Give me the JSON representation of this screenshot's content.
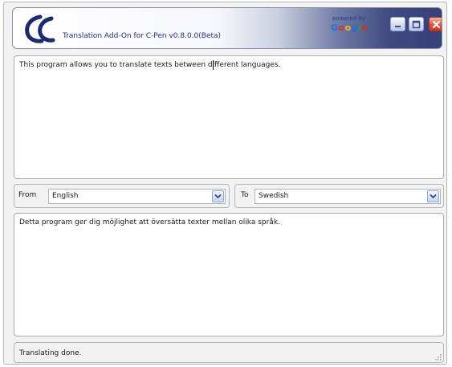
{
  "window": {
    "title": "Translation Add-On for C-Pen v0.8.0.0(Beta)",
    "powered_by": "powered by",
    "google_letters": [
      "G",
      "o",
      "o",
      "g",
      "l",
      "e"
    ],
    "colors": {
      "title_gradient_end": "#35407a",
      "close_button": "#e2553e",
      "accent": "#26307a"
    }
  },
  "controls": {
    "minimize": "minimize-icon",
    "maximize": "maximize-icon",
    "close": "close-icon"
  },
  "source": {
    "text": "This program allows you to translate texts between different languages."
  },
  "languages": {
    "from_label": "From",
    "from_value": "English",
    "to_label": "To",
    "to_value": "Swedish"
  },
  "target": {
    "text": "Detta program ger dig möjlighet att översätta texter mellan olika språk."
  },
  "status": {
    "text": "Translating done."
  }
}
